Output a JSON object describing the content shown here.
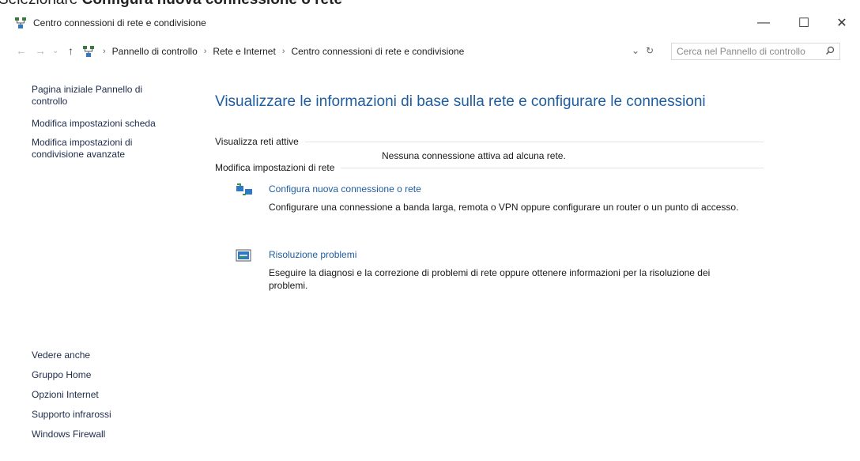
{
  "caption": {
    "prefix": "Selezionare ",
    "bold": "Configura nuova connessione o rete"
  },
  "window": {
    "title": "Centro connessioni di rete e condivisione"
  },
  "address": {
    "breadcrumb": [
      "Pannello di controllo",
      "Rete e Internet",
      "Centro connessioni di rete e condivisione"
    ],
    "search_placeholder": "Cerca nel Pannello di controllo"
  },
  "sidebar": {
    "home": "Pagina iniziale Pannello di controllo",
    "links": [
      "Modifica impostazioni scheda",
      "Modifica impostazioni di condivisione avanzate"
    ],
    "see_also_title": "Vedere anche",
    "see_also": [
      "Gruppo Home",
      "Opzioni Internet",
      "Supporto infrarossi",
      "Windows Firewall"
    ]
  },
  "main": {
    "heading": "Visualizzare le informazioni di base sulla rete e configurare le connessioni",
    "active_title": "Visualizza reti attive",
    "active_status": "Nessuna connessione attiva ad alcuna rete.",
    "settings_title": "Modifica impostazioni di rete",
    "items": [
      {
        "link": "Configura nuova connessione o rete",
        "desc": "Configurare una connessione a banda larga, remota o VPN oppure configurare un router o un punto di accesso."
      },
      {
        "link": "Risoluzione problemi",
        "desc": "Eseguire la diagnosi e la correzione di problemi di rete oppure ottenere informazioni per la risoluzione dei problemi."
      }
    ]
  }
}
